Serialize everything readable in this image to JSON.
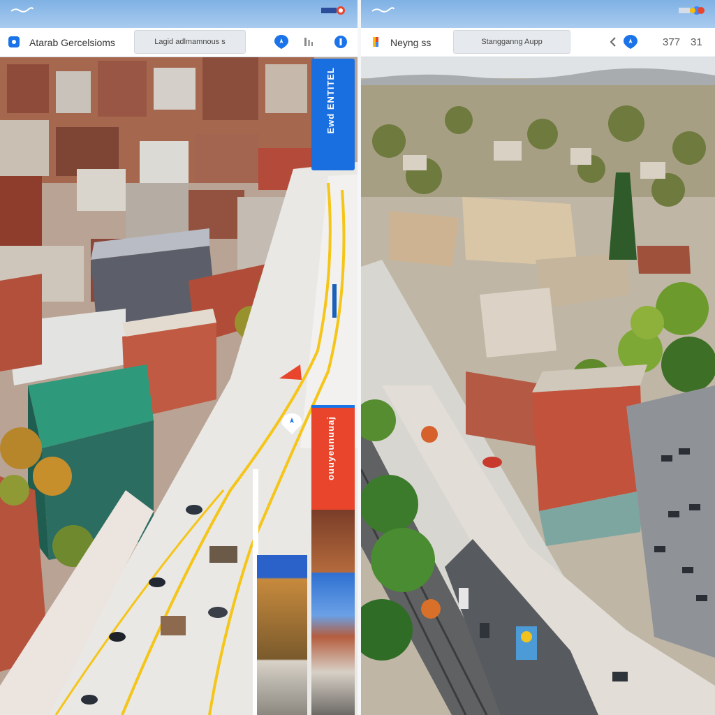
{
  "left_window": {
    "title": "Atarab Gercelsioms",
    "search": "Lagid adlmamnous s",
    "side_card_top_label": "Ewd ENTITEL",
    "side_card_bottom_label": "ouuyeunuuaj"
  },
  "right_window": {
    "title": "Neyng ss",
    "search": "Stangganng Aupp",
    "counter_a": "377",
    "counter_b": "31"
  },
  "icons": {
    "left": [
      "map-pin-icon",
      "share-icon",
      "info-icon",
      "location-marker-icon",
      "flag-icon"
    ],
    "right": [
      "map-pin-icon",
      "back-chevron-icon",
      "location-pin-icon"
    ]
  },
  "colors": {
    "accent_blue": "#1a73e8",
    "accent_red": "#e8452c",
    "road_yellow": "#f5c518"
  }
}
